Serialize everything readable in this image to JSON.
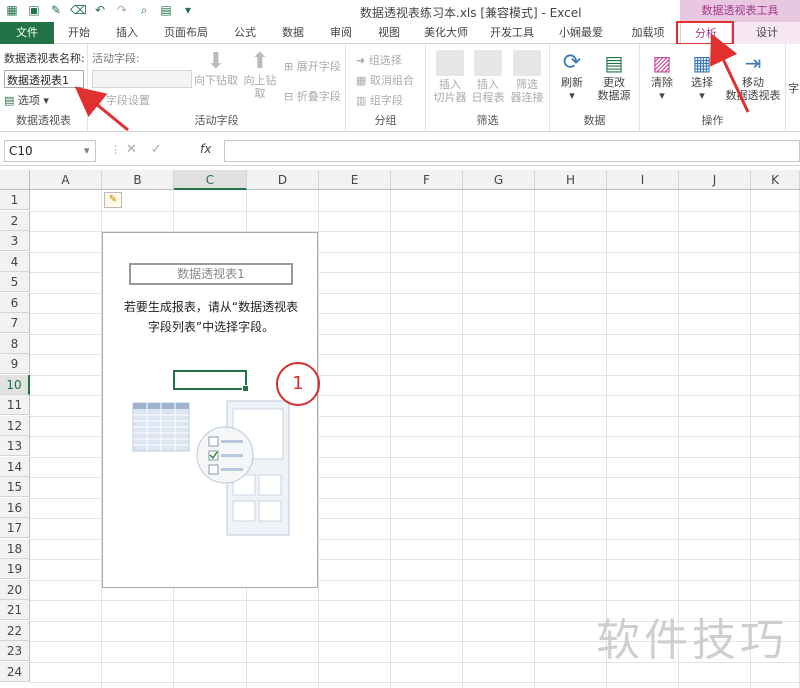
{
  "window": {
    "title": "数据透视表练习本.xls  [兼容模式] - Excel",
    "context_header": "数据透视表工具"
  },
  "tabs": [
    "文件",
    "开始",
    "插入",
    "页面布局",
    "公式",
    "数据",
    "审阅",
    "视图",
    "美化大师",
    "开发工具",
    "小娴最爱",
    "加载项",
    "分析",
    "设计"
  ],
  "ribbon": {
    "pivot_name_label": "数据透视表名称:",
    "pivot_name_value": "数据透视表1",
    "options_label": "选项",
    "group_pivot": "数据透视表",
    "active_field_label": "活动字段:",
    "field_settings": "字段设置",
    "drill_down": "向下钻取",
    "drill_up_1": "向上钻",
    "drill_up_2": "取",
    "expand_field": "展开字段",
    "collapse_field": "折叠字段",
    "group_active": "活动字段",
    "group_selection": "组选择",
    "ungroup": "取消组合",
    "group_field": "组字段",
    "group_group": "分组",
    "insert_slicer_1": "插入",
    "insert_slicer_2": "切片器",
    "insert_timeline_1": "插入",
    "insert_timeline_2": "日程表",
    "filter_conn_1": "筛选",
    "filter_conn_2": "器连接",
    "group_filter": "筛选",
    "refresh": "刷新",
    "change_source_1": "更改",
    "change_source_2": "数据源",
    "group_data": "数据",
    "clear": "清除",
    "select": "选择",
    "move_1": "移动",
    "move_2": "数据透视表",
    "group_actions": "操作",
    "cut_char": "字"
  },
  "formula_bar": {
    "name_box": "C10",
    "fx": "fx",
    "content": ""
  },
  "columns": [
    "A",
    "B",
    "C",
    "D",
    "E",
    "F",
    "G",
    "H",
    "I",
    "J",
    "K"
  ],
  "rows": [
    "1",
    "2",
    "3",
    "4",
    "5",
    "6",
    "7",
    "8",
    "9",
    "10",
    "11",
    "12",
    "13",
    "14",
    "15",
    "16",
    "17",
    "18",
    "19",
    "20",
    "21",
    "22",
    "23",
    "24"
  ],
  "selected_cell": "C10",
  "pivot_placeholder": {
    "name": "数据透视表1",
    "msg_line1": "若要生成报表，请从“数据透视表",
    "msg_line2": "字段列表”中选择字段。"
  },
  "annotation": {
    "circle_label": "1"
  },
  "watermark": "软件技巧",
  "colors": {
    "excel_green": "#217346",
    "context_pink": "#a03a8a",
    "annotation_red": "#e03030"
  }
}
